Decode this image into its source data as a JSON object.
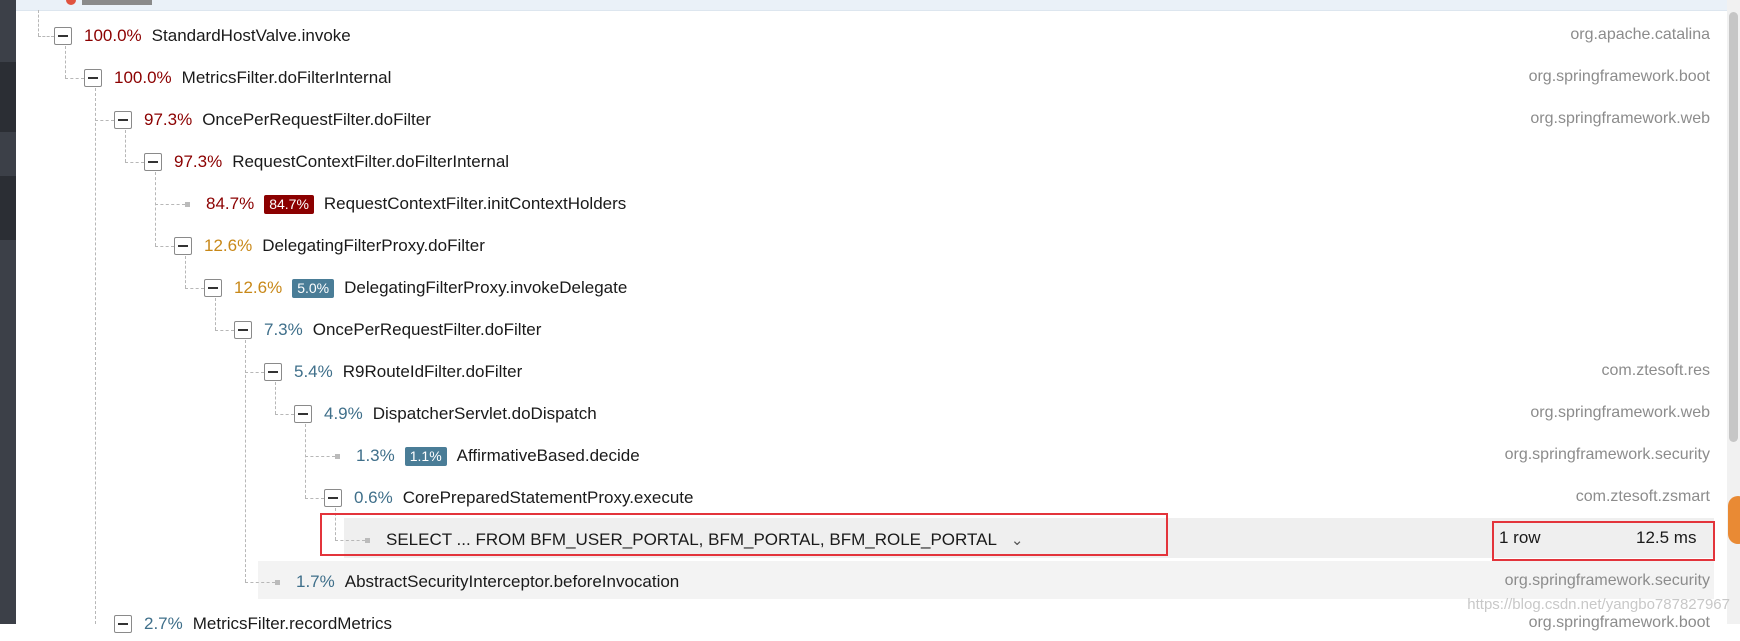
{
  "rows": [
    {
      "pct": "100.0%",
      "method": "StandardHostValve.invoke",
      "pkg": "org.apache.catalina"
    },
    {
      "pct": "100.0%",
      "method": "MetricsFilter.doFilterInternal",
      "pkg": "org.springframework.boot"
    },
    {
      "pct": "97.3%",
      "method": "OncePerRequestFilter.doFilter",
      "pkg": "org.springframework.web"
    },
    {
      "pct": "97.3%",
      "method": "RequestContextFilter.doFilterInternal",
      "pkg": ""
    },
    {
      "pct": "84.7%",
      "badge": "84.7%",
      "method": "RequestContextFilter.initContextHolders",
      "pkg": ""
    },
    {
      "pct": "12.6%",
      "method": "DelegatingFilterProxy.doFilter",
      "pkg": ""
    },
    {
      "pct": "12.6%",
      "badge": "5.0%",
      "method": "DelegatingFilterProxy.invokeDelegate",
      "pkg": ""
    },
    {
      "pct": "7.3%",
      "method": "OncePerRequestFilter.doFilter",
      "pkg": ""
    },
    {
      "pct": "5.4%",
      "method": "R9RouteIdFilter.doFilter",
      "pkg": "com.ztesoft.res"
    },
    {
      "pct": "4.9%",
      "method": "DispatcherServlet.doDispatch",
      "pkg": "org.springframework.web"
    },
    {
      "pct": "1.3%",
      "badge": "1.1%",
      "method": "AffirmativeBased.decide",
      "pkg": "org.springframework.security"
    },
    {
      "pct": "0.6%",
      "method": "CorePreparedStatementProxy.execute",
      "pkg": "com.ztesoft.zsmart"
    },
    {
      "pct": "1.7%",
      "method": "AbstractSecurityInterceptor.beforeInvocation",
      "pkg": "org.springframework.security"
    },
    {
      "pct": "2.7%",
      "method": "MetricsFilter.recordMetrics",
      "pkg": "org.springframework.boot"
    }
  ],
  "sql": {
    "text": "SELECT ... FROM BFM_USER_PORTAL, BFM_PORTAL, BFM_ROLE_PORTAL",
    "rows": "1 row",
    "time": "12.5 ms"
  },
  "watermark": "https://blog.csdn.net/yangbo787827967",
  "colors": {
    "hot": "#8b0000",
    "warm": "#c88818",
    "cool": "#3f6f8a",
    "highlight_box": "#e3343b"
  }
}
